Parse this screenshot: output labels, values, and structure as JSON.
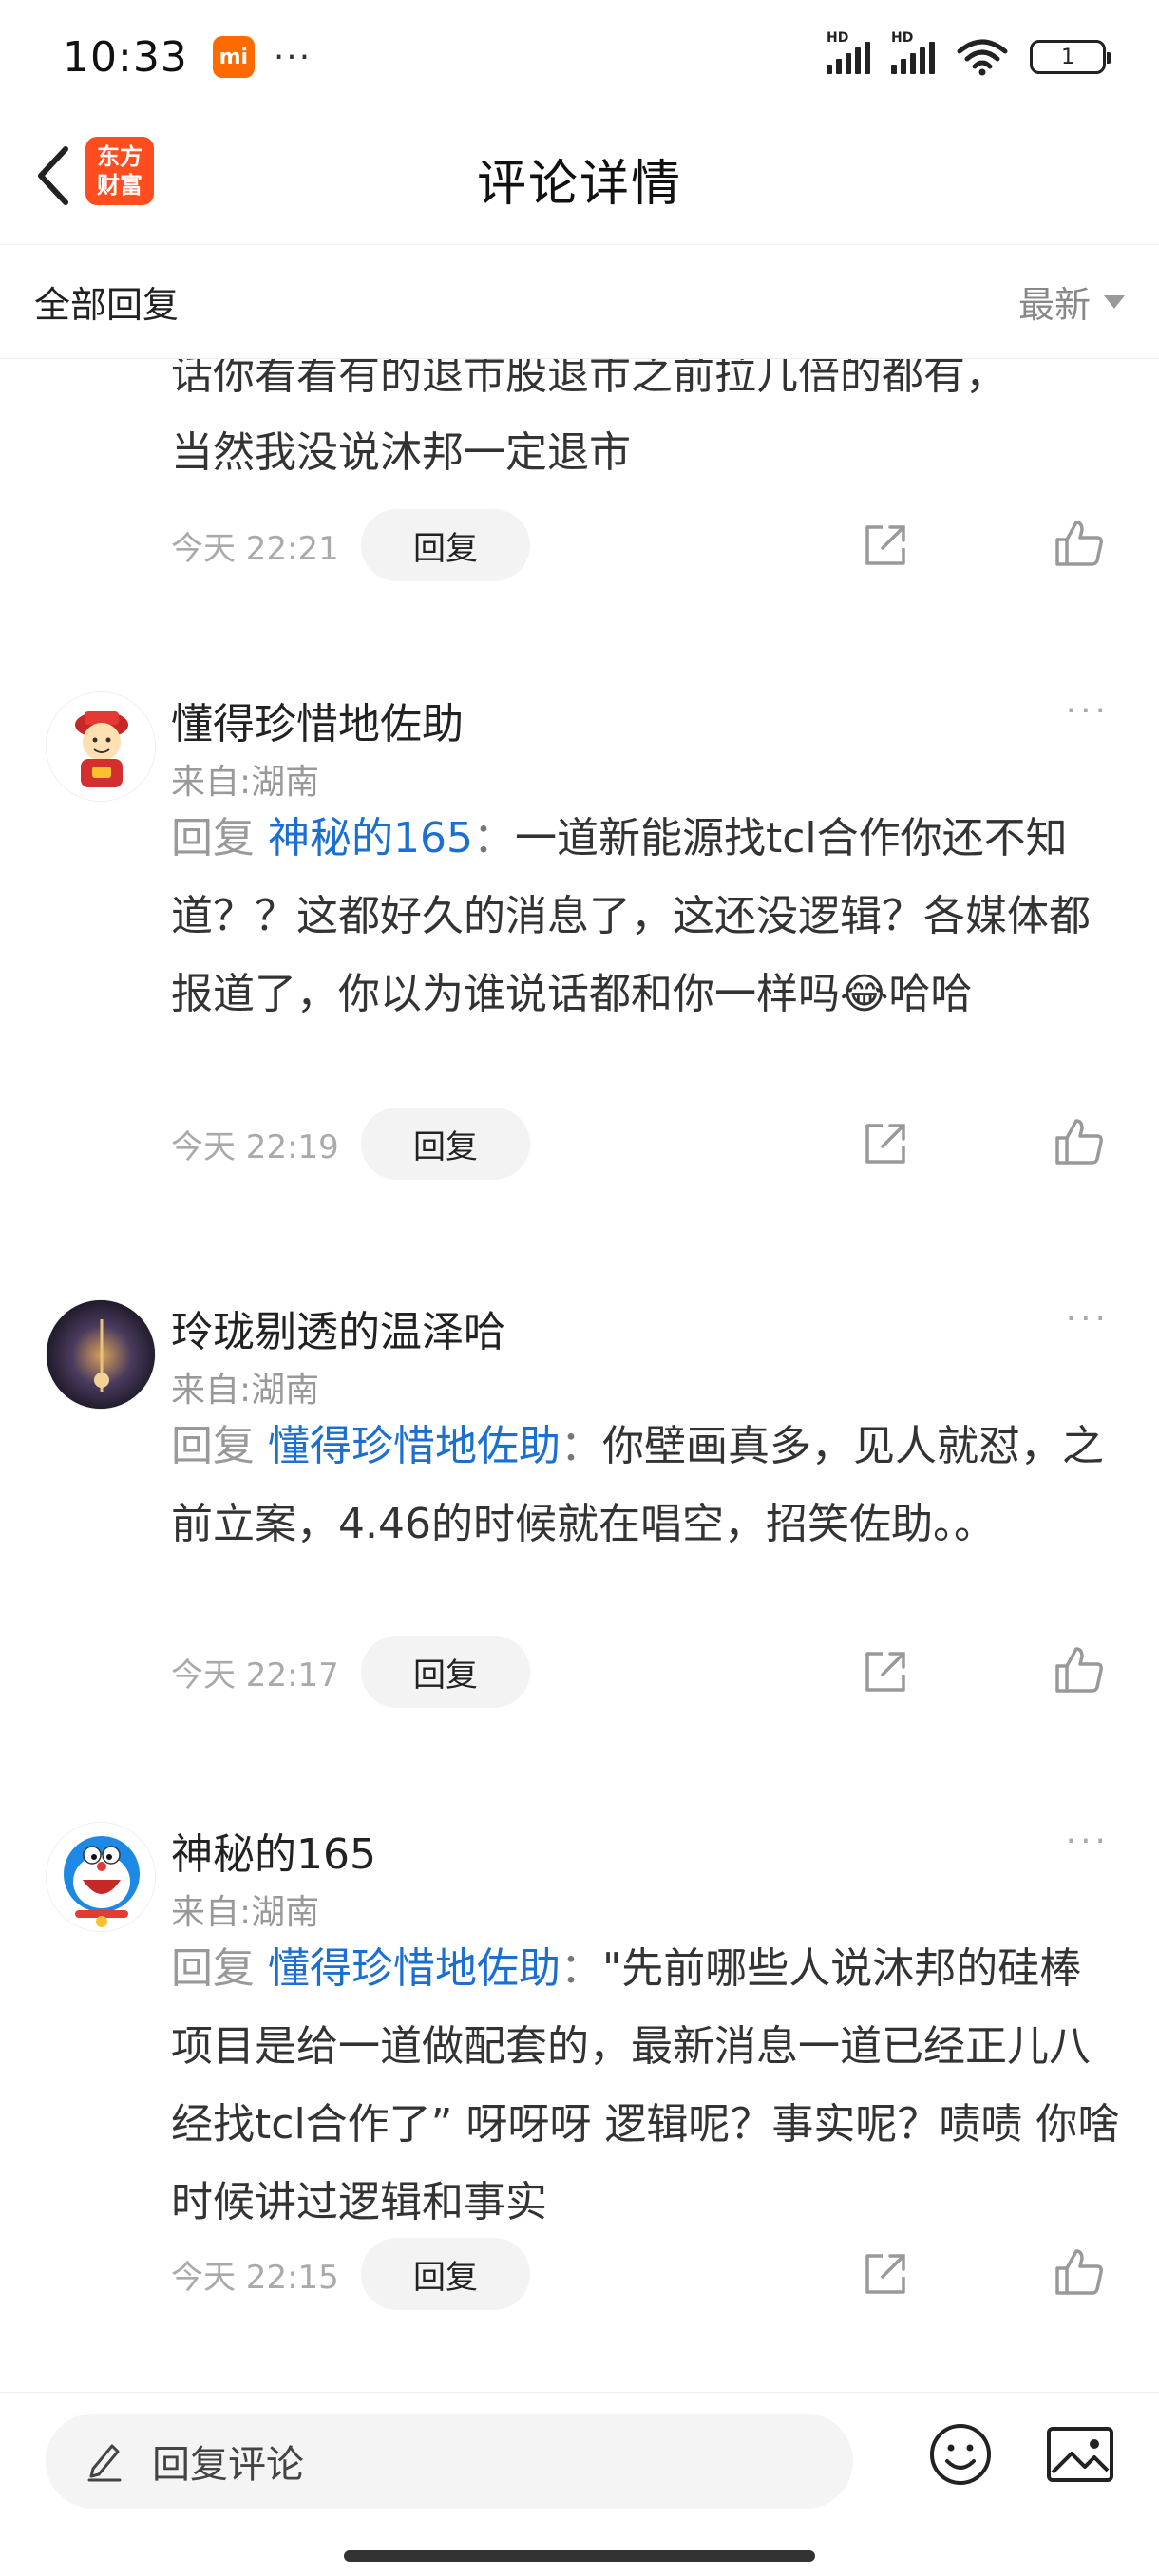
{
  "status_bar": {
    "time": "10:33",
    "mi_label": "mi",
    "more_dots": "···",
    "signal_label_1": "HD",
    "signal_label_2": "HD",
    "battery": "1"
  },
  "nav": {
    "title": "评论详情",
    "logo_line1": "东方",
    "logo_line2": "财富"
  },
  "filter": {
    "label": "全部回复",
    "sort": "最新"
  },
  "comments": [
    {
      "body_line1": "话你看看有的退市股退市之前拉几倍的都有，",
      "body_line2": "当然我没说沐邦一定退市",
      "time": "今天 22:21",
      "reply_label": "回复"
    },
    {
      "user": "懂得珍惜地佐助",
      "location": "来自:湖南",
      "reply_word": "回复",
      "mention": "神秘的165",
      "colon": "：",
      "text": "一道新能源找tcl合作你还不知道？？这都好久的消息了，这还没逻辑？各媒体都报道了，你以为谁说话都和你一样吗",
      "emoji": "😂",
      "text_tail": "哈哈",
      "time": "今天 22:19",
      "reply_label": "回复",
      "more": "···"
    },
    {
      "user": "玲珑剔透的温泽哈",
      "location": "来自:湖南",
      "reply_word": "回复",
      "mention": "懂得珍惜地佐助",
      "colon": "：",
      "text": "你壁画真多，见人就怼，之前立案，4.46的时候就在唱空，招笑佐助。。",
      "time": "今天 22:17",
      "reply_label": "回复",
      "more": "···"
    },
    {
      "user": "神秘的165",
      "location": "来自:湖南",
      "reply_word": "回复",
      "mention": "懂得珍惜地佐助",
      "colon": "：",
      "text": "\"先前哪些人说沐邦的硅棒项目是给一道做配套的，最新消息一道已经正儿八经找tcl合作了” 呀呀呀  逻辑呢？事实呢？啧啧  你啥时候讲过逻辑和事实",
      "time": "今天 22:15",
      "reply_label": "回复",
      "more": "···"
    }
  ],
  "bottom": {
    "placeholder": "回复评论"
  },
  "colors": {
    "accent_blue": "#1b6fd1",
    "brand_orange": "#ff4d1f"
  },
  "icons": [
    "back-arrow-icon",
    "share-icon",
    "like-thumb-icon",
    "pencil-icon",
    "emoji-icon",
    "image-icon",
    "wifi-icon",
    "signal-icon",
    "battery-icon"
  ]
}
